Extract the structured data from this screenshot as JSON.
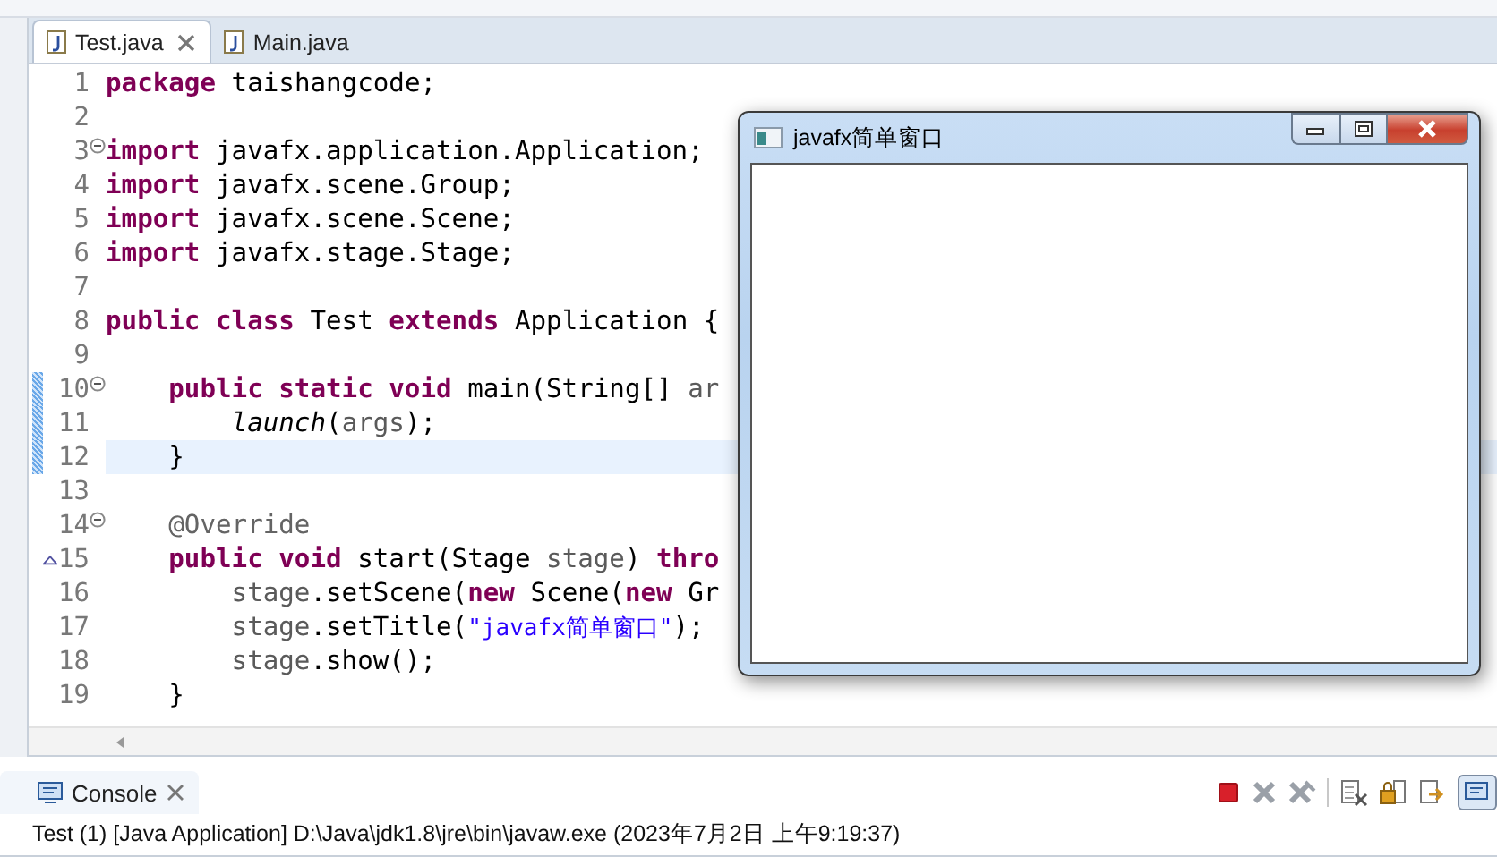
{
  "editor_tabs": [
    {
      "label": "Test.java",
      "selected": true,
      "closable": true
    },
    {
      "label": "Main.java",
      "selected": false,
      "closable": false
    }
  ],
  "code_lines": [
    {
      "number": "1",
      "changed": false,
      "current": false,
      "collapsible": false,
      "overrides": false,
      "tokens": [
        {
          "kind": "keyword",
          "text": "package"
        },
        {
          "kind": "plain",
          "text": " taishangcode;"
        }
      ]
    },
    {
      "number": "2",
      "changed": false,
      "current": false,
      "collapsible": false,
      "overrides": false
    },
    {
      "number": "3",
      "changed": false,
      "current": false,
      "collapsible": true,
      "overrides": false,
      "tokens": [
        {
          "kind": "keyword",
          "text": "import"
        },
        {
          "kind": "plain",
          "text": " javafx.application.Application;"
        }
      ]
    },
    {
      "number": "4",
      "changed": false,
      "current": false,
      "collapsible": false,
      "overrides": false,
      "tokens": [
        {
          "kind": "keyword",
          "text": "import"
        },
        {
          "kind": "plain",
          "text": " javafx.scene.Group;"
        }
      ]
    },
    {
      "number": "5",
      "changed": false,
      "current": false,
      "collapsible": false,
      "overrides": false,
      "tokens": [
        {
          "kind": "keyword",
          "text": "import"
        },
        {
          "kind": "plain",
          "text": " javafx.scene.Scene;"
        }
      ]
    },
    {
      "number": "6",
      "changed": false,
      "current": false,
      "collapsible": false,
      "overrides": false,
      "tokens": [
        {
          "kind": "keyword",
          "text": "import"
        },
        {
          "kind": "plain",
          "text": " javafx.stage.Stage;"
        }
      ]
    },
    {
      "number": "7",
      "changed": false,
      "current": false,
      "collapsible": false,
      "overrides": false
    },
    {
      "number": "8",
      "changed": false,
      "current": false,
      "collapsible": false,
      "overrides": false,
      "tokens": [
        {
          "kind": "keyword",
          "text": "public class"
        },
        {
          "kind": "plain",
          "text": " Test "
        },
        {
          "kind": "keyword",
          "text": "extends"
        },
        {
          "kind": "plain",
          "text": " Application {"
        }
      ]
    },
    {
      "number": "9",
      "changed": false,
      "current": false,
      "collapsible": false,
      "overrides": false
    },
    {
      "number": "10",
      "changed": true,
      "current": false,
      "collapsible": true,
      "overrides": false,
      "tokens": [
        {
          "kind": "keyword",
          "text": "    public static void"
        },
        {
          "kind": "plain",
          "text": " main(String[] "
        },
        {
          "kind": "variable",
          "text": "ar"
        }
      ]
    },
    {
      "number": "11",
      "changed": true,
      "current": false,
      "collapsible": false,
      "overrides": false,
      "tokens": [
        {
          "kind": "static_call",
          "text": "        launch"
        },
        {
          "kind": "plain",
          "text": "("
        },
        {
          "kind": "variable",
          "text": "args"
        },
        {
          "kind": "plain",
          "text": ");"
        }
      ]
    },
    {
      "number": "12",
      "changed": true,
      "current": true,
      "collapsible": false,
      "overrides": false,
      "tokens": [
        {
          "kind": "plain",
          "text": "    }"
        }
      ]
    },
    {
      "number": "13",
      "changed": false,
      "current": false,
      "collapsible": false,
      "overrides": false
    },
    {
      "number": "14",
      "changed": false,
      "current": false,
      "collapsible": true,
      "overrides": false,
      "tokens": [
        {
          "kind": "annotation",
          "text": "    @Override"
        }
      ]
    },
    {
      "number": "15",
      "changed": false,
      "current": false,
      "collapsible": false,
      "overrides": true,
      "tokens": [
        {
          "kind": "keyword",
          "text": "    public void"
        },
        {
          "kind": "plain",
          "text": " start(Stage "
        },
        {
          "kind": "variable",
          "text": "stage"
        },
        {
          "kind": "plain",
          "text": ") "
        },
        {
          "kind": "keyword",
          "text": "thro"
        }
      ]
    },
    {
      "number": "16",
      "changed": false,
      "current": false,
      "collapsible": false,
      "overrides": false,
      "tokens": [
        {
          "kind": "variable",
          "text": "        stage"
        },
        {
          "kind": "plain",
          "text": ".setScene("
        },
        {
          "kind": "keyword",
          "text": "new"
        },
        {
          "kind": "plain",
          "text": " Scene("
        },
        {
          "kind": "keyword",
          "text": "new"
        },
        {
          "kind": "plain",
          "text": " Gr"
        }
      ]
    },
    {
      "number": "17",
      "changed": false,
      "current": false,
      "collapsible": false,
      "overrides": false,
      "tokens": [
        {
          "kind": "variable",
          "text": "        stage"
        },
        {
          "kind": "plain",
          "text": ".setTitle("
        },
        {
          "kind": "string",
          "text": "\"javafx简单窗口\""
        },
        {
          "kind": "plain",
          "text": ");"
        }
      ]
    },
    {
      "number": "18",
      "changed": false,
      "current": false,
      "collapsible": false,
      "overrides": false,
      "tokens": [
        {
          "kind": "variable",
          "text": "        stage"
        },
        {
          "kind": "plain",
          "text": ".show();"
        }
      ]
    },
    {
      "number": "19",
      "changed": false,
      "current": false,
      "collapsible": false,
      "overrides": false,
      "tokens": [
        {
          "kind": "plain",
          "text": "    }"
        }
      ]
    }
  ],
  "app_window": {
    "title": "javafx简单窗口"
  },
  "console": {
    "tab_label": "Console",
    "status": "Test (1) [Java Application] D:\\Java\\jdk1.8\\jre\\bin\\javaw.exe (2023年7月2日 上午9:19:37)"
  }
}
